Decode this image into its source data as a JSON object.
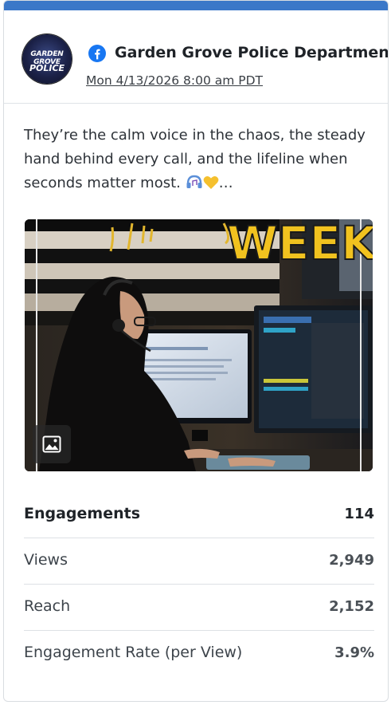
{
  "colors": {
    "top_bar": "#3b78c8",
    "facebook_blue": "#1877f2"
  },
  "post": {
    "page_name": "Garden Grove Police Department",
    "timestamp": "Mon 4/13/2026 8:00 am PDT",
    "text": "They’re the calm voice in the chaos, the steady hand behind every call, and the lifeline when seconds matter most. ",
    "ellipsis": "…",
    "avatar_line1": "GARDEN GROVE",
    "avatar_line2": "POLICE",
    "image_banner_text": "WEEK",
    "media_type_icon": "image-icon",
    "network_icon": "facebook-icon"
  },
  "stats": [
    {
      "label": "Engagements",
      "value": "114"
    },
    {
      "label": "Views",
      "value": "2,949"
    },
    {
      "label": "Reach",
      "value": "2,152"
    },
    {
      "label": "Engagement Rate (per View)",
      "value": "3.9%"
    }
  ]
}
